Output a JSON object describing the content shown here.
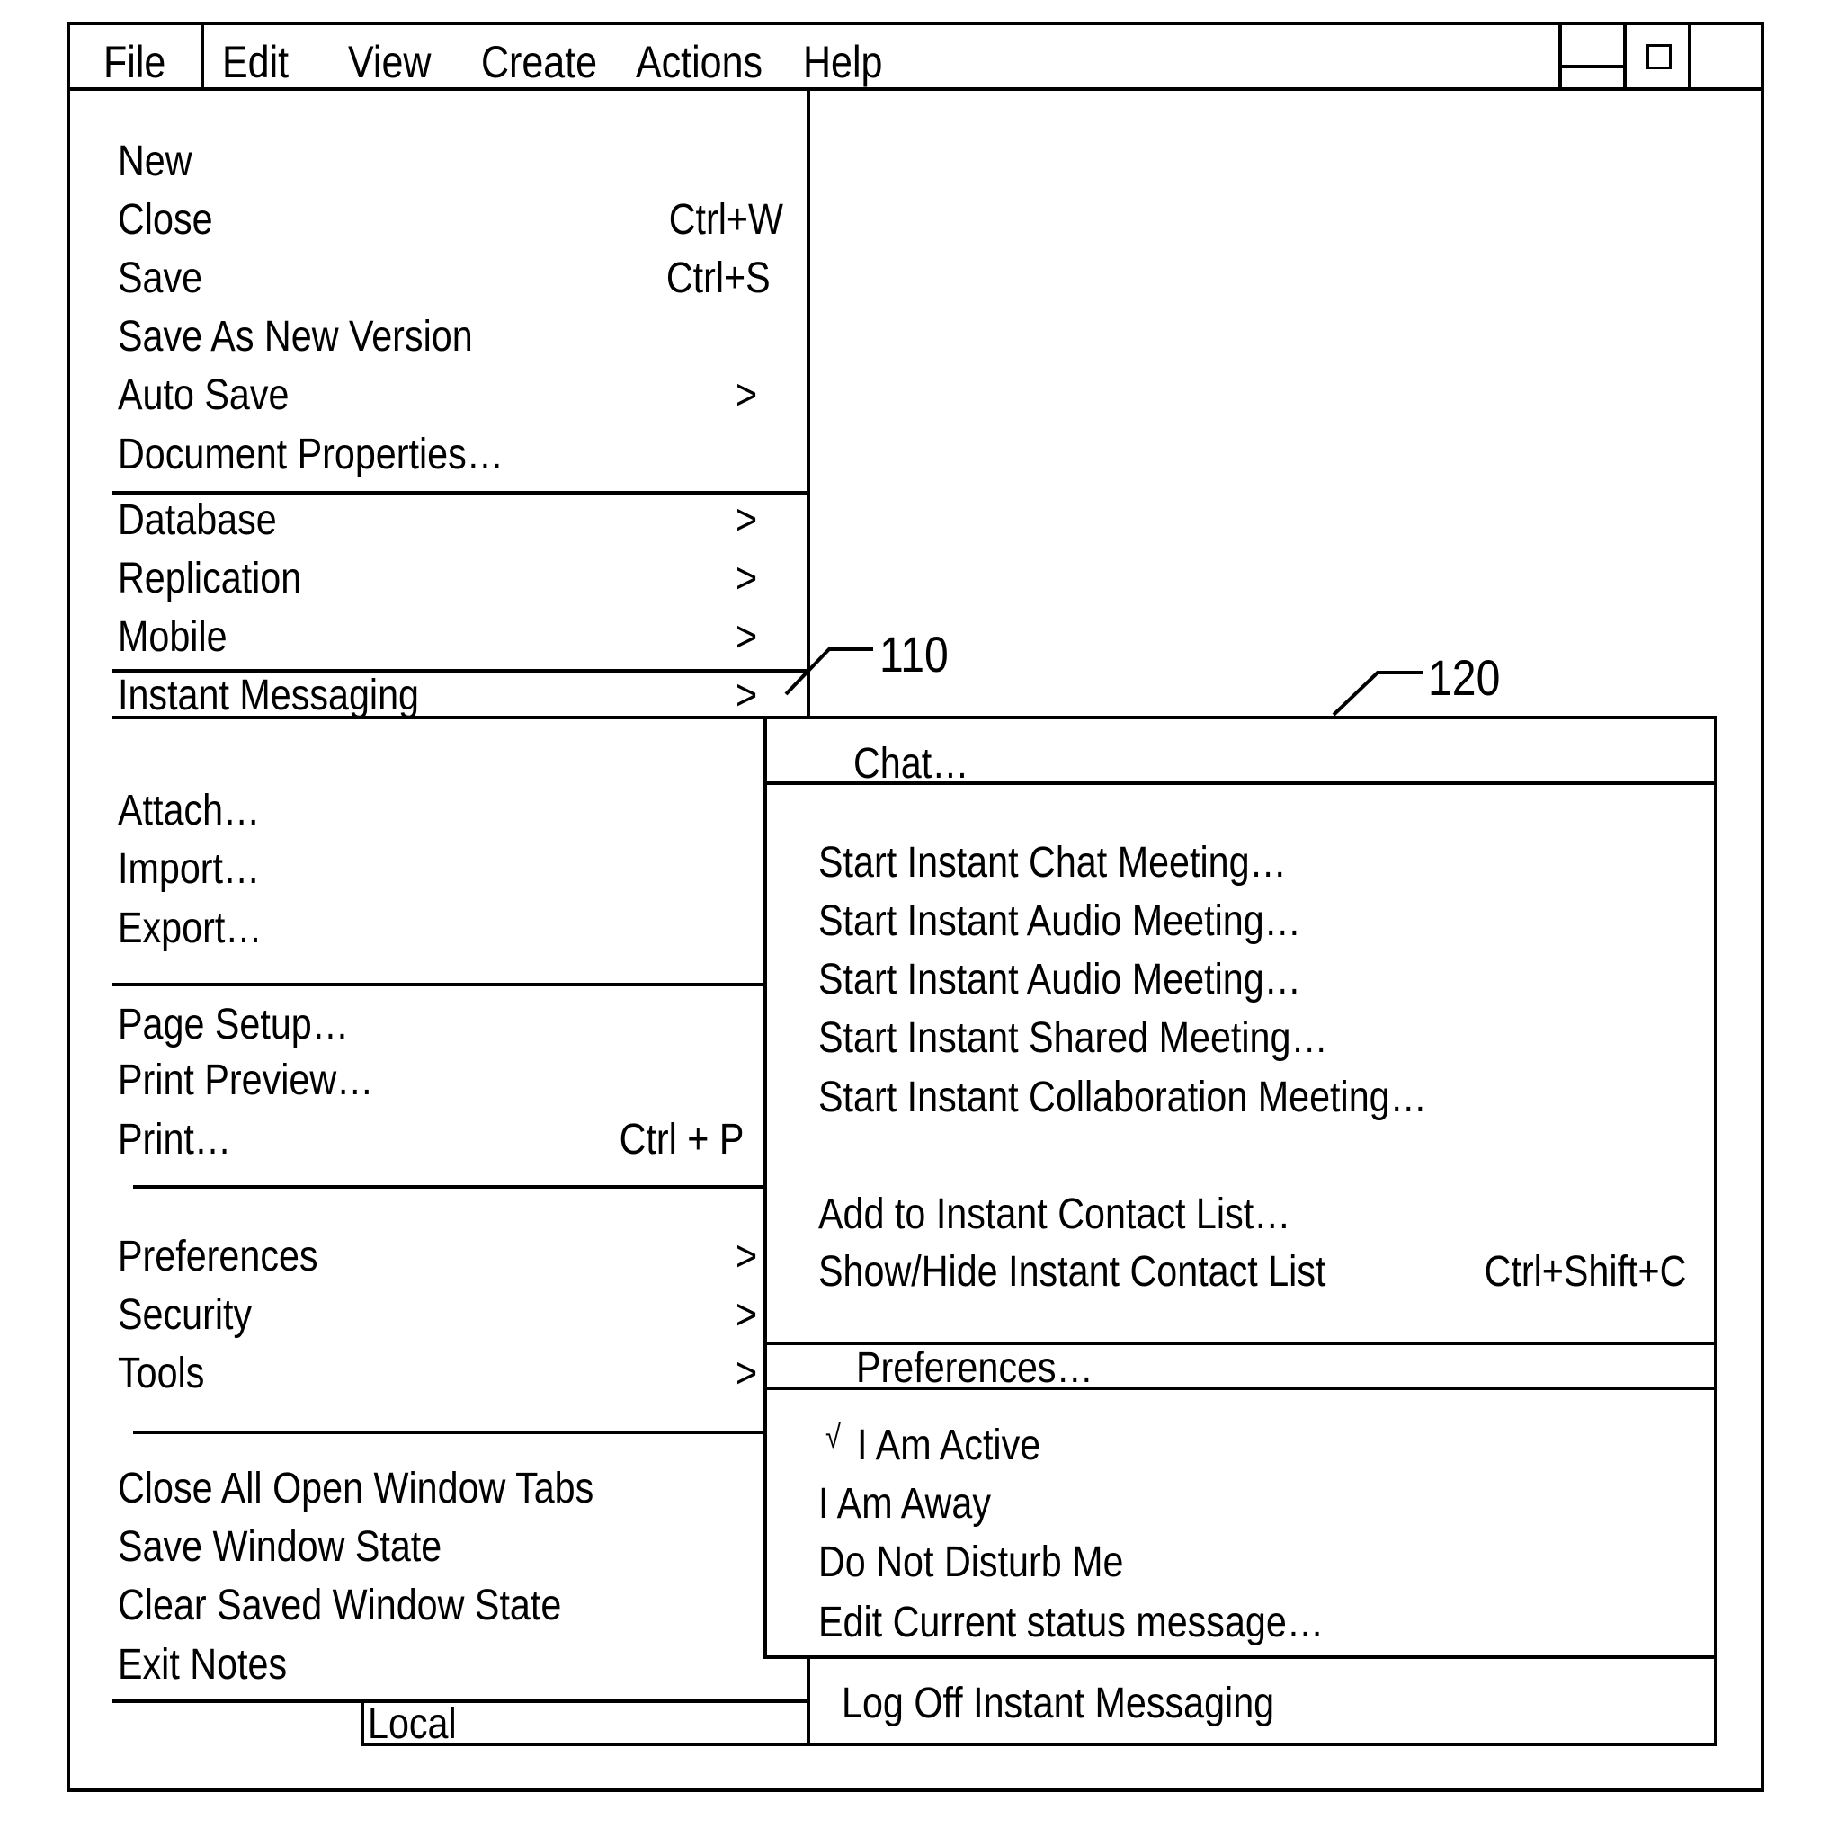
{
  "menubar": {
    "items": [
      "File",
      "Edit",
      "View",
      "Create",
      "Actions",
      "Help"
    ]
  },
  "window_controls": {
    "minimize": "minimize-icon",
    "maximize": "maximize-icon",
    "close": "close-icon"
  },
  "file_menu": {
    "groups": [
      [
        {
          "label": "New",
          "shortcut": ""
        },
        {
          "label": "Close",
          "shortcut": "Ctrl+W"
        },
        {
          "label": "Save",
          "shortcut": "Ctrl+S"
        },
        {
          "label": "Save As New Version",
          "shortcut": ""
        },
        {
          "label": "Auto Save",
          "shortcut": ">"
        },
        {
          "label": "Document Properties…",
          "shortcut": ""
        }
      ],
      [
        {
          "label": "Database",
          "shortcut": ">"
        },
        {
          "label": "Replication",
          "shortcut": ">"
        },
        {
          "label": "Mobile",
          "shortcut": ">"
        },
        {
          "label": "Instant Messaging",
          "shortcut": ">"
        }
      ],
      [
        {
          "label": "Attach…",
          "shortcut": ""
        },
        {
          "label": "Import…",
          "shortcut": ""
        },
        {
          "label": "Export…",
          "shortcut": ""
        }
      ],
      [
        {
          "label": "Page Setup…",
          "shortcut": ""
        },
        {
          "label": "Print Preview…",
          "shortcut": ""
        },
        {
          "label": "Print…",
          "shortcut": "Ctrl + P"
        }
      ],
      [
        {
          "label": "Preferences",
          "shortcut": ">"
        },
        {
          "label": "Security",
          "shortcut": ">"
        },
        {
          "label": "Tools",
          "shortcut": ">"
        }
      ],
      [
        {
          "label": "Close All Open Window Tabs",
          "shortcut": ""
        },
        {
          "label": "Save Window State",
          "shortcut": ""
        },
        {
          "label": "Clear Saved Window State",
          "shortcut": ""
        },
        {
          "label": "Exit Notes",
          "shortcut": ""
        }
      ]
    ],
    "footer_tab": "Local"
  },
  "im_submenu": {
    "chat": "Chat…",
    "meetings": [
      "Start Instant Chat Meeting…",
      "Start Instant Audio Meeting…",
      "Start Instant Audio Meeting…",
      "Start Instant Shared Meeting…",
      "Start Instant Collaboration Meeting…"
    ],
    "contacts": [
      {
        "label": "Add to Instant Contact List…",
        "shortcut": ""
      },
      {
        "label": "Show/Hide Instant Contact List",
        "shortcut": "Ctrl+Shift+C"
      }
    ],
    "preferences": "Preferences…",
    "status": [
      {
        "label": "I Am Active",
        "checked": true,
        "check_mark": "√"
      },
      {
        "label": "I Am Away",
        "checked": false
      },
      {
        "label": "Do Not Disturb Me",
        "checked": false
      },
      {
        "label": "Edit Current status message…",
        "checked": false
      }
    ],
    "log_off": "Log Off Instant Messaging"
  },
  "callouts": {
    "file_menu_ref": "110",
    "submenu_ref": "120"
  }
}
